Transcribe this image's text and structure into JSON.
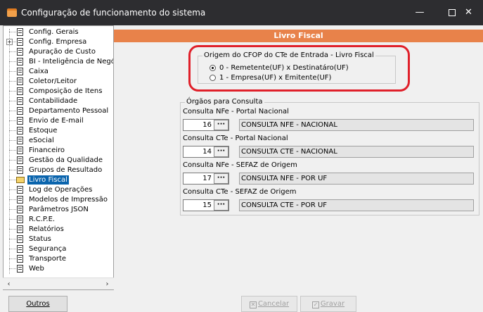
{
  "window": {
    "title": "Configuração de funcionamento do sistema",
    "controls": {
      "minimize": "—",
      "maximize": "",
      "close": "✕"
    }
  },
  "tree": {
    "items": [
      {
        "label": "Config. Gerais",
        "icon": "document-icon"
      },
      {
        "label": "Config. Empresa",
        "icon": "document-icon",
        "expander": "+"
      },
      {
        "label": "Apuração de Custo",
        "icon": "document-icon"
      },
      {
        "label": "BI - Inteligência de Negócio",
        "icon": "document-icon"
      },
      {
        "label": "Caixa",
        "icon": "document-icon"
      },
      {
        "label": "Coletor/Leitor",
        "icon": "document-icon"
      },
      {
        "label": "Composição de Itens",
        "icon": "document-icon"
      },
      {
        "label": "Contabilidade",
        "icon": "document-icon"
      },
      {
        "label": "Departamento Pessoal",
        "icon": "document-icon"
      },
      {
        "label": "Envio de E-mail",
        "icon": "document-icon"
      },
      {
        "label": "Estoque",
        "icon": "document-icon"
      },
      {
        "label": "eSocial",
        "icon": "document-icon"
      },
      {
        "label": "Financeiro",
        "icon": "document-icon"
      },
      {
        "label": "Gestão da Qualidade",
        "icon": "document-icon"
      },
      {
        "label": "Grupos de Resultado",
        "icon": "document-icon"
      },
      {
        "label": "Livro Fiscal",
        "icon": "folder-open-icon",
        "selected": true
      },
      {
        "label": "Log de Operações",
        "icon": "document-icon"
      },
      {
        "label": "Modelos de Impressão",
        "icon": "document-icon"
      },
      {
        "label": "Parâmetros JSON",
        "icon": "document-icon"
      },
      {
        "label": "R.C.P.E.",
        "icon": "document-icon"
      },
      {
        "label": "Relatórios",
        "icon": "document-icon"
      },
      {
        "label": "Status",
        "icon": "document-icon"
      },
      {
        "label": "Segurança",
        "icon": "document-icon"
      },
      {
        "label": "Transporte",
        "icon": "document-icon"
      },
      {
        "label": "Web",
        "icon": "document-icon"
      }
    ],
    "scroll_left": "‹",
    "scroll_right": "›"
  },
  "panel": {
    "header": "Livro Fiscal",
    "header_color": "#e8824a",
    "origem_group": {
      "legend": "Origem do CFOP do CTe de Entrada - Livro Fiscal",
      "options": [
        {
          "label": "0 - Remetente(UF) x Destinatáro(UF)",
          "checked": true
        },
        {
          "label": "1 - Empresa(UF) x Emitente(UF)",
          "checked": false
        }
      ]
    },
    "orgaos_group": {
      "legend": "Órgãos para Consulta",
      "fields": [
        {
          "label": "Consulta NFe - Portal Nacional",
          "value": "16",
          "description": "CONSULTA NFE - NACIONAL"
        },
        {
          "label": "Consulta CTe - Portal Nacional",
          "value": "14",
          "description": "CONSULTA CTE - NACIONAL"
        },
        {
          "label": "Consulta NFe - SEFAZ de Origem",
          "value": "17",
          "description": "CONSULTA NFE - POR UF"
        },
        {
          "label": "Consulta CTe - SEFAZ de Origem",
          "value": "15",
          "description": "CONSULTA CTE - POR UF"
        }
      ],
      "lookup_label": "···"
    }
  },
  "footer": {
    "outros": "Outros",
    "cancelar": "Cancelar",
    "gravar": "Gravar"
  },
  "colors": {
    "titlebar": "#2d2d30",
    "selection": "#0a64ad",
    "highlight": "#e0202a"
  }
}
